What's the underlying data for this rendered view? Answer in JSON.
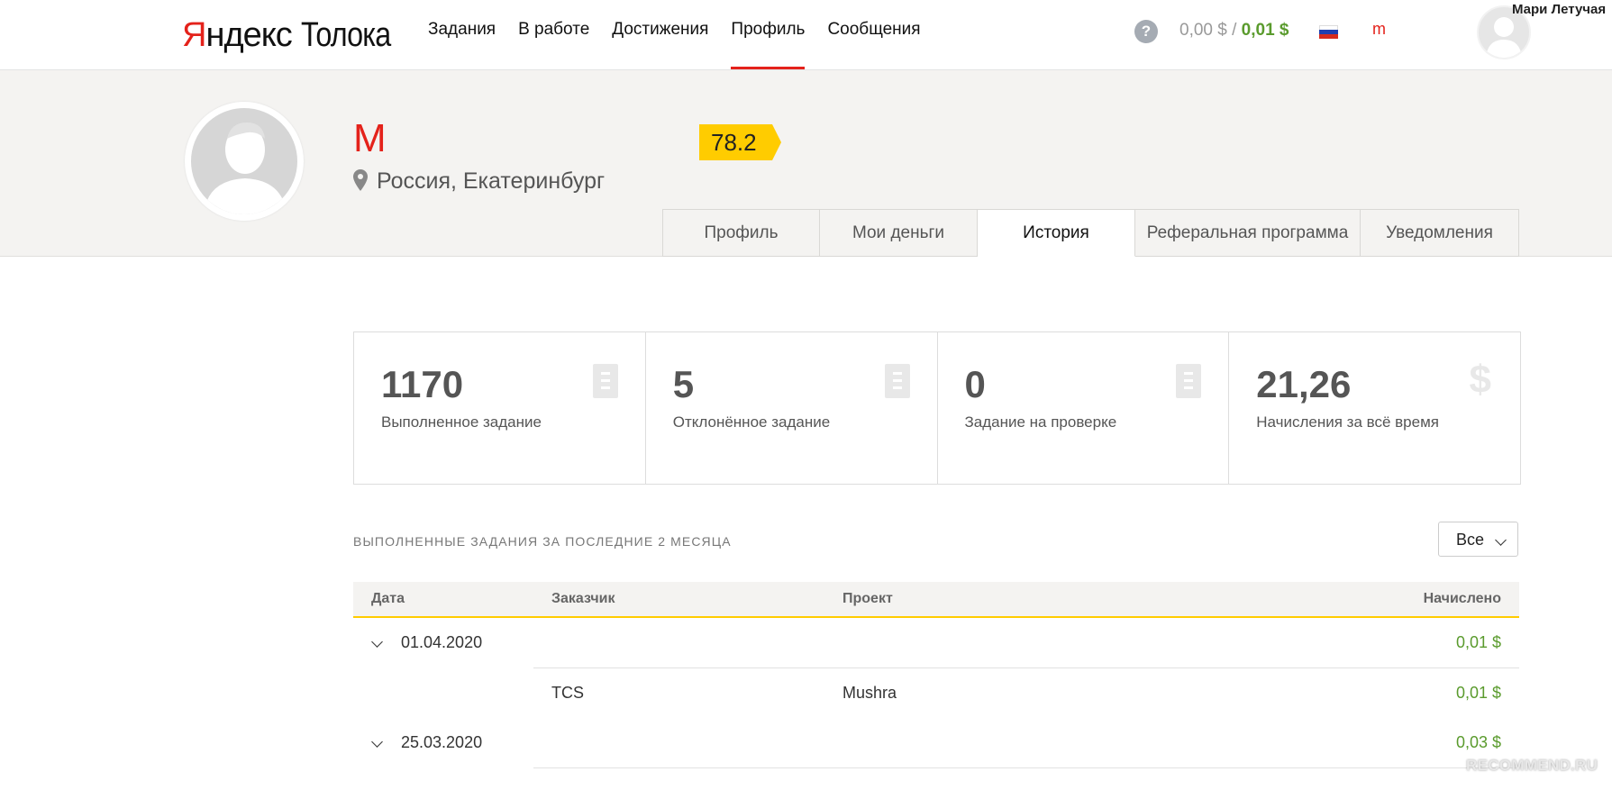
{
  "header": {
    "logo_prefix": "Я",
    "logo_word": "ндекс",
    "logo_product": "Толока",
    "nav": [
      {
        "label": "Задания"
      },
      {
        "label": "В работе"
      },
      {
        "label": "Достижения"
      },
      {
        "label": "Профиль"
      },
      {
        "label": "Сообщения"
      }
    ],
    "active_nav": "Профиль",
    "help_label": "?",
    "balance_pending": "0,00 $",
    "balance_separator": " / ",
    "balance_available": "0,01 $",
    "user_login": "m",
    "user_name": "Мари Летучая",
    "colors": {
      "brand_red": "#e4221b",
      "money_green": "#5a9b2d"
    },
    "icons": {
      "help": "question-icon",
      "flag": "russia-flag-icon",
      "avatar": "user-avatar-icon"
    }
  },
  "profile": {
    "name": "М",
    "location": "Россия, Екатеринбург",
    "rating": "78.2",
    "tabs": [
      {
        "label": "Профиль"
      },
      {
        "label": "Мои деньги"
      },
      {
        "label": "История"
      },
      {
        "label": "Реферальная программа"
      },
      {
        "label": "Уведомления"
      }
    ],
    "active_tab": "История",
    "rating_color": "#ffcc00"
  },
  "stats": [
    {
      "value": "1170",
      "label": "Выполненное задание",
      "icon": "document-icon"
    },
    {
      "value": "5",
      "label": "Отклонённое задание",
      "icon": "document-icon"
    },
    {
      "value": "0",
      "label": "Задание на проверке",
      "icon": "document-icon"
    },
    {
      "value": "21,26",
      "label": "Начисления за всё время",
      "icon": "dollar-icon",
      "icon_text": "$"
    }
  ],
  "history": {
    "title": "ВЫПОЛНЕННЫЕ ЗАДАНИЯ ЗА ПОСЛЕДНИЕ 2 МЕСЯЦА",
    "filter_value": "Все",
    "columns": {
      "date": "Дата",
      "customer": "Заказчик",
      "project": "Проект",
      "earned": "Начислено"
    },
    "groups": [
      {
        "date": "01.04.2020",
        "total": "0,01 $",
        "rows": [
          {
            "customer": "TCS",
            "project": "Mushra",
            "amount": "0,01 $"
          }
        ]
      },
      {
        "date": "25.03.2020",
        "total": "0,03 $",
        "rows": []
      }
    ]
  },
  "watermark": "RECOMMEND.RU"
}
